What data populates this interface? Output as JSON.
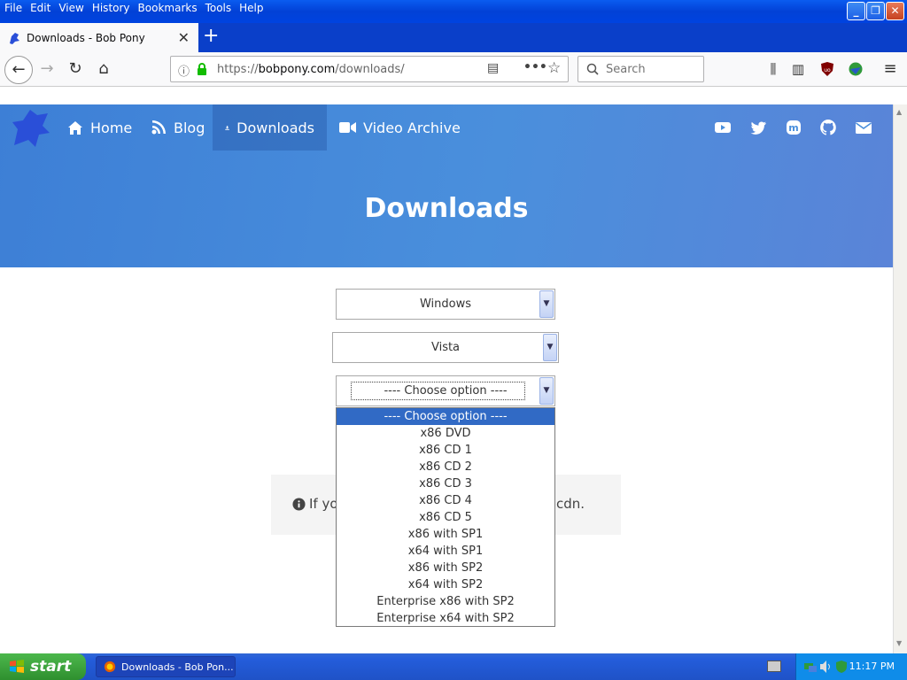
{
  "browser": {
    "menu": [
      "File",
      "Edit",
      "View",
      "History",
      "Bookmarks",
      "Tools",
      "Help"
    ],
    "tab_title": "Downloads - Bob Pony",
    "url_prefix": "https://",
    "url_host": "bobpony.com",
    "url_path": "/downloads/",
    "search_placeholder": "Search"
  },
  "site": {
    "nav": [
      {
        "label": "Home",
        "icon": "home-icon"
      },
      {
        "label": "Blog",
        "icon": "rss-icon"
      },
      {
        "label": "Downloads",
        "icon": "download-icon",
        "active": true
      },
      {
        "label": "Video Archive",
        "icon": "video-icon"
      }
    ],
    "social": [
      "youtube-icon",
      "twitter-icon",
      "mastodon-icon",
      "github-icon",
      "mail-icon"
    ],
    "hero_title": "Downloads"
  },
  "selects": {
    "os": "Windows",
    "version": "Vista",
    "option": "---- Choose option ----"
  },
  "dropdown": {
    "options": [
      "---- Choose option ----",
      "x86 DVD",
      "x86 CD 1",
      "x86 CD 2",
      "x86 CD 3",
      "x86 CD 4",
      "x86 CD 5",
      "x86 with SP1",
      "x64 with SP1",
      "x86 with SP2",
      "x64 with SP2",
      "Enterprise x86 with SP2",
      "Enterprise x64 with SP2"
    ],
    "selected_index": 0
  },
  "info": {
    "left_text": "If yo",
    "right_text": "cdn."
  },
  "taskbar": {
    "start_label": "start",
    "task_label": "Downloads - Bob Pon...",
    "clock": "11:17 PM"
  }
}
